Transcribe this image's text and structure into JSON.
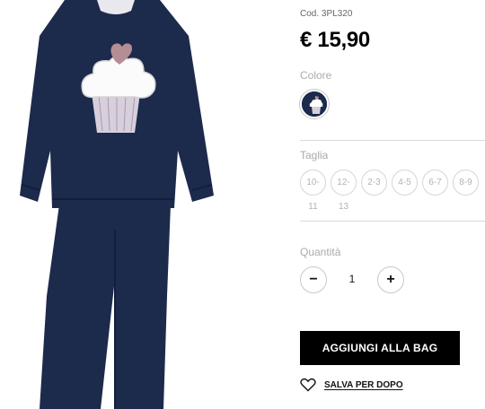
{
  "product": {
    "code": "Cod. 3PL320",
    "price": "€ 15,90",
    "image_icon": "pajama-cupcake-image"
  },
  "colors": {
    "label": "Colore",
    "selected_swatch": "navy-cupcake-swatch",
    "swatch_color": "#1c2a4c"
  },
  "sizes": {
    "label": "Taglia",
    "options": [
      "10-",
      "12-",
      "2-3",
      "4-5",
      "6-7",
      "8-9"
    ],
    "wrap_suffixes": [
      "11",
      "13"
    ]
  },
  "quantity": {
    "label": "Quantità",
    "value": "1",
    "minus_symbol": "−",
    "plus_symbol": "+"
  },
  "actions": {
    "add_to_bag": "AGGIUNGI ALLA BAG",
    "save_for_later": "SALVA PER DOPO"
  },
  "theme": {
    "navy": "#1c2a4c",
    "button_bg": "#000000",
    "muted": "#b3b3b3"
  }
}
